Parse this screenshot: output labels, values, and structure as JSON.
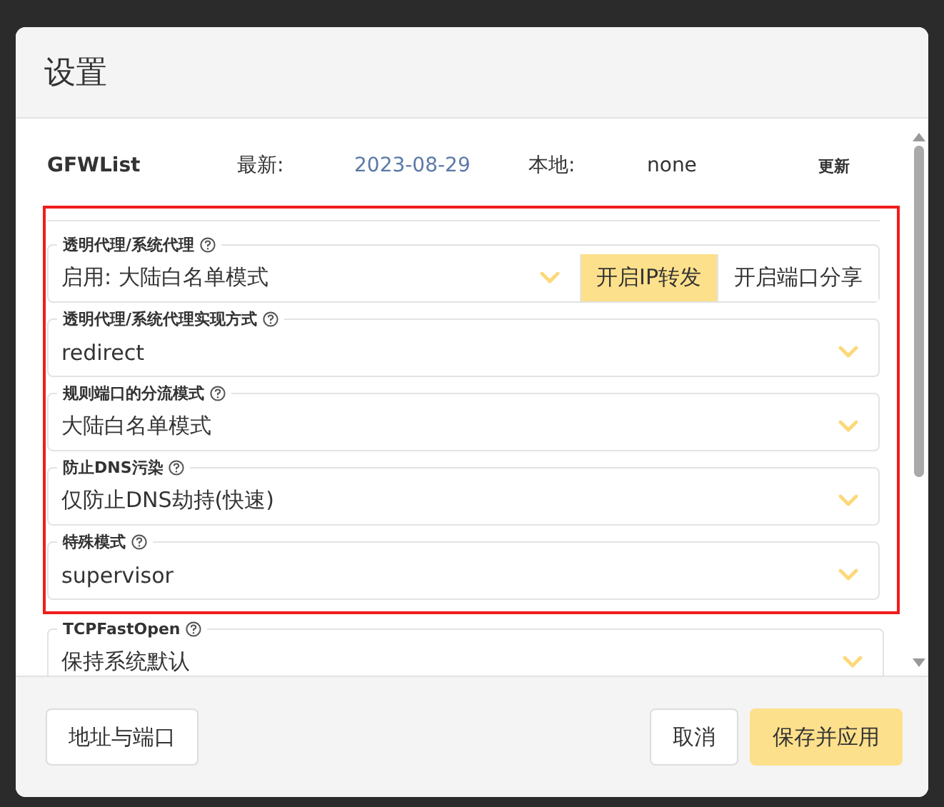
{
  "dialog": {
    "title": "设置"
  },
  "gfwlist": {
    "name": "GFWList",
    "latest_label": "最新:",
    "latest": "2023-08-29",
    "local_label": "本地:",
    "local": "none",
    "update_button": "更新"
  },
  "fields": [
    {
      "label": "透明代理/系统代理",
      "value": "启用: 大陆白名单模式",
      "highlighted": true,
      "buttons": [
        {
          "label": "开启IP转发",
          "selected": true
        },
        {
          "label": "开启端口分享",
          "selected": false
        }
      ]
    },
    {
      "label": "透明代理/系统代理实现方式",
      "value": "redirect",
      "highlighted": true
    },
    {
      "label": "规则端口的分流模式",
      "value": "大陆白名单模式",
      "highlighted": true
    },
    {
      "label": "防止DNS污染",
      "value": "仅防止DNS劫持(快速)",
      "highlighted": true
    },
    {
      "label": "特殊模式",
      "value": "supervisor",
      "highlighted": true
    },
    {
      "label": "TCPFastOpen",
      "value": "保持系统默认",
      "highlighted": false
    }
  ],
  "footer": {
    "left_button": "地址与端口",
    "cancel_button": "取消",
    "save_button": "保存并应用"
  }
}
